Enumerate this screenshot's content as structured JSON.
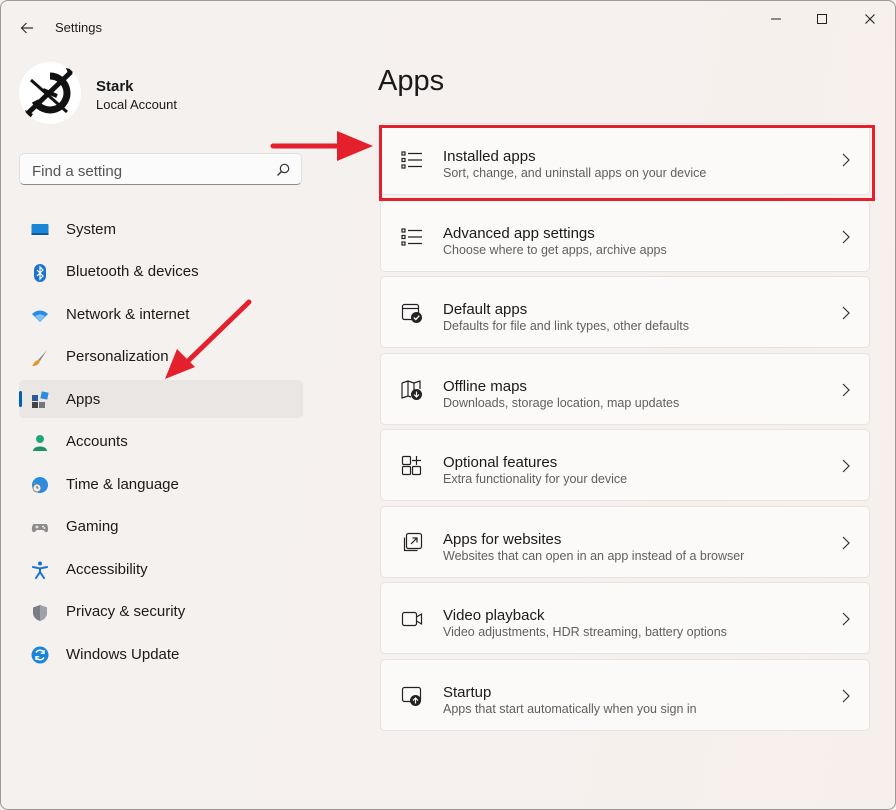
{
  "window": {
    "title": "Settings"
  },
  "profile": {
    "name": "Stark",
    "account_type": "Local Account"
  },
  "search": {
    "placeholder": "Find a setting"
  },
  "nav": {
    "items": [
      {
        "label": "System",
        "icon": "monitor-icon"
      },
      {
        "label": "Bluetooth & devices",
        "icon": "bluetooth-icon"
      },
      {
        "label": "Network & internet",
        "icon": "wifi-icon"
      },
      {
        "label": "Personalization",
        "icon": "paintbrush-icon"
      },
      {
        "label": "Apps",
        "icon": "apps-icon",
        "active": true
      },
      {
        "label": "Accounts",
        "icon": "person-icon"
      },
      {
        "label": "Time & language",
        "icon": "globe-clock-icon"
      },
      {
        "label": "Gaming",
        "icon": "gamepad-icon"
      },
      {
        "label": "Accessibility",
        "icon": "accessibility-icon"
      },
      {
        "label": "Privacy & security",
        "icon": "shield-icon"
      },
      {
        "label": "Windows Update",
        "icon": "update-icon"
      }
    ]
  },
  "main": {
    "title": "Apps",
    "cards": [
      {
        "title": "Installed apps",
        "subtitle": "Sort, change, and uninstall apps on your device",
        "icon": "list-icon"
      },
      {
        "title": "Advanced app settings",
        "subtitle": "Choose where to get apps, archive apps",
        "icon": "list-settings-icon"
      },
      {
        "title": "Default apps",
        "subtitle": "Defaults for file and link types, other defaults",
        "icon": "default-apps-icon"
      },
      {
        "title": "Offline maps",
        "subtitle": "Downloads, storage location, map updates",
        "icon": "map-download-icon"
      },
      {
        "title": "Optional features",
        "subtitle": "Extra functionality for your device",
        "icon": "add-grid-icon"
      },
      {
        "title": "Apps for websites",
        "subtitle": "Websites that can open in an app instead of a browser",
        "icon": "open-app-icon"
      },
      {
        "title": "Video playback",
        "subtitle": "Video adjustments, HDR streaming, battery options",
        "icon": "video-camera-icon"
      },
      {
        "title": "Startup",
        "subtitle": "Apps that start automatically when you sign in",
        "icon": "startup-icon"
      }
    ]
  },
  "colors": {
    "accent": "#005fb8",
    "annotation": "#e3202b"
  }
}
